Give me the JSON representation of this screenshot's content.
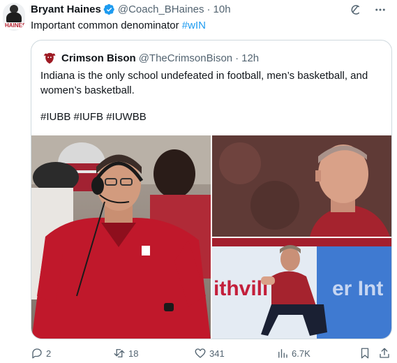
{
  "tweet": {
    "author_name": "Bryant Haines",
    "handle": "@Coach_BHaines",
    "separator": "·",
    "time": "10h",
    "text": "Important common denominator ",
    "hashtag": "#wIN",
    "avatar_tag": "HAINES"
  },
  "quote": {
    "author_name": "Crimson Bison",
    "handle": "@TheCrimsonBison",
    "separator": "·",
    "time": "12h",
    "text": "Indiana is the only school undefeated in football, men’s basketball, and women’s basketball.",
    "hashtags": "#IUBB #IUFB #IUWBB",
    "photos": [
      {
        "icon": "coach-headset-photo",
        "alt": "Football coach wearing headset"
      },
      {
        "icon": "basketball-coach-photo",
        "alt": "Men's basketball coach"
      },
      {
        "icon": "womens-coach-photo",
        "alt": "Women's basketball coach crouching",
        "banner_text": "ithvill",
        "banner_text_right": "er Int"
      }
    ]
  },
  "actions": {
    "replies": "2",
    "reposts": "18",
    "likes": "341",
    "views": "6.7K"
  },
  "colors": {
    "accent": "#1d9bf0",
    "text": "#0f1419",
    "secondary": "#536471",
    "border": "#cfd9de",
    "iu_red": "#b51f2e"
  }
}
